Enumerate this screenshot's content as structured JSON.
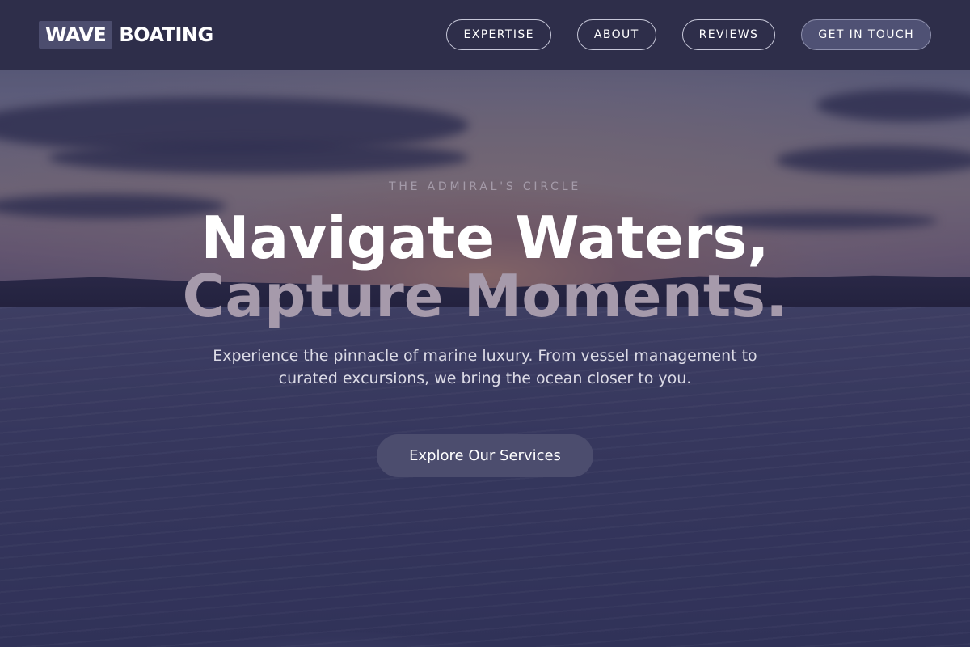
{
  "header": {
    "logo_part_1": "WAVE",
    "logo_part_2": "BOATING",
    "nav": [
      {
        "label": "EXPERTISE"
      },
      {
        "label": "ABOUT"
      },
      {
        "label": "REVIEWS"
      },
      {
        "label": "GET IN TOUCH"
      }
    ]
  },
  "hero": {
    "eyebrow": "THE ADMIRAL'S CIRCLE",
    "headline_line_1": "Navigate Waters,",
    "headline_line_2": "Capture Moments.",
    "description": "Experience the pinnacle of marine luxury. From vessel management to curated excursions, we bring the ocean closer to you.",
    "cta_label": "Explore Our Services"
  },
  "colors": {
    "header_bg": "#2e2e4a",
    "accent": "#4c4d6e",
    "headline_secondary": "#a69aab"
  }
}
